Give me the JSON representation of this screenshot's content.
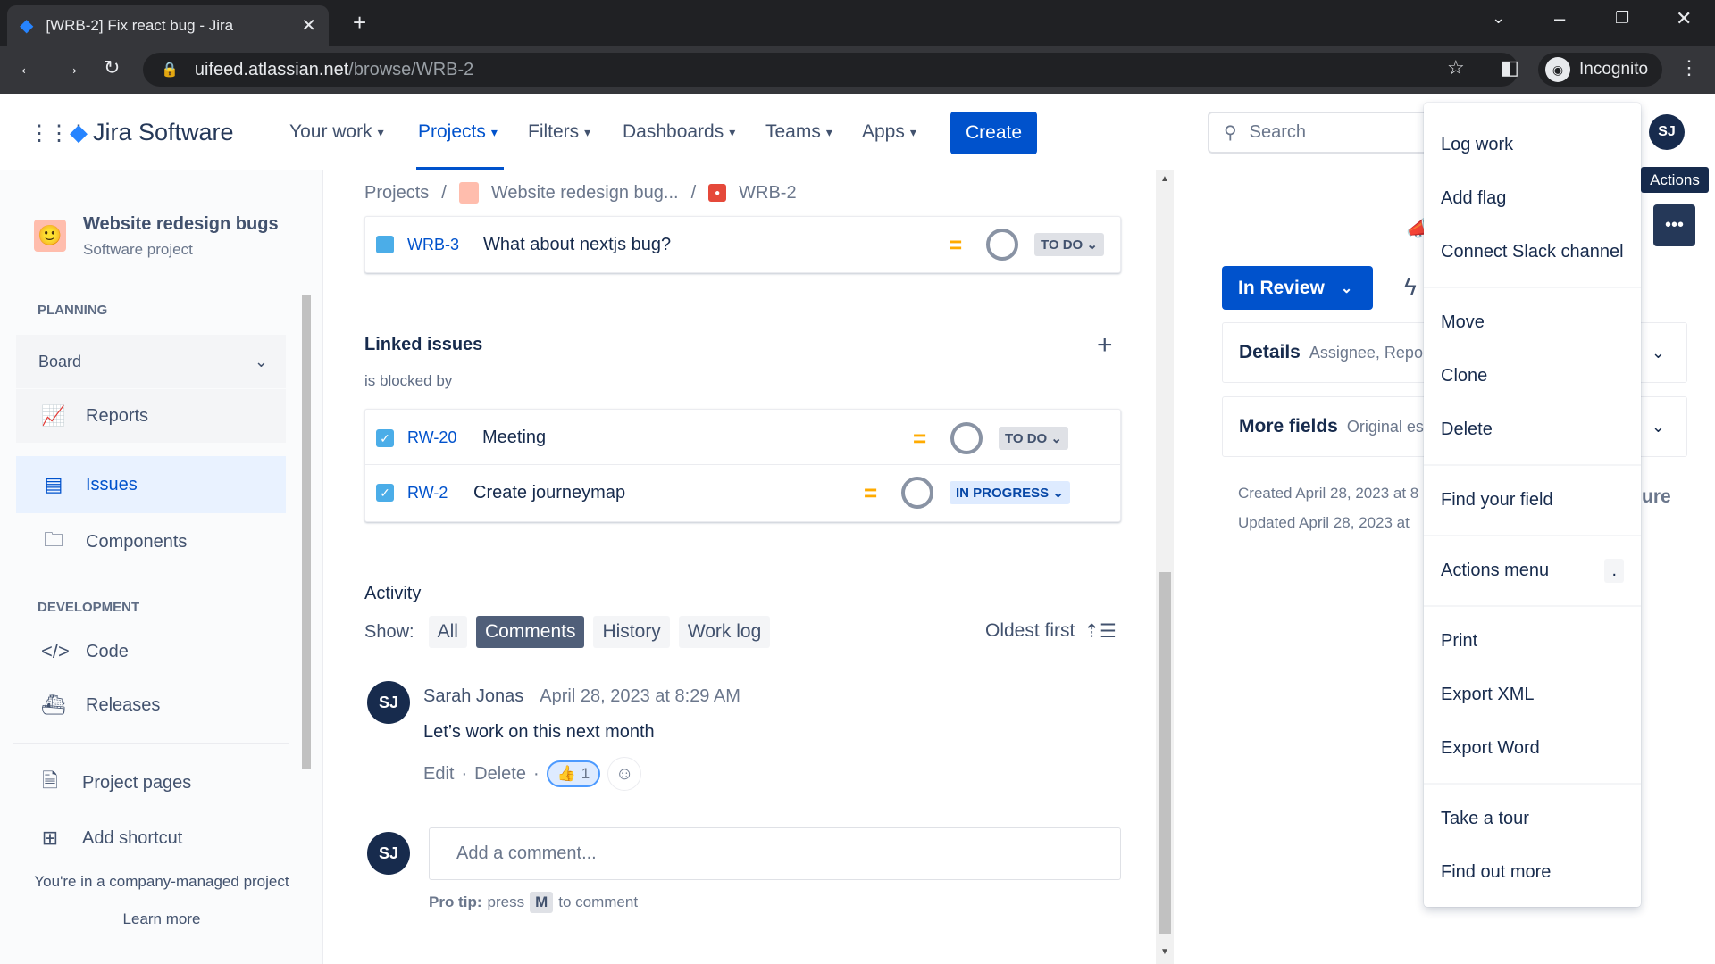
{
  "browser": {
    "tab_title": "[WRB-2] Fix react bug - Jira",
    "url_host": "uifeed.atlassian.net",
    "url_path": "/browse/WRB-2",
    "profile": "Incognito"
  },
  "header": {
    "product": "Jira Software",
    "nav": [
      "Your work",
      "Projects",
      "Filters",
      "Dashboards",
      "Teams",
      "Apps"
    ],
    "active_nav": "Projects",
    "create": "Create",
    "search_placeholder": "Search",
    "avatar": "SJ"
  },
  "sidebar": {
    "project_name": "Website redesign bugs",
    "project_type": "Software project",
    "planning_heading": "PLANNING",
    "board": "Board",
    "reports": "Reports",
    "issues": "Issues",
    "components": "Components",
    "development_heading": "DEVELOPMENT",
    "code": "Code",
    "releases": "Releases",
    "project_pages": "Project pages",
    "add_shortcut": "Add shortcut",
    "footer": "You're in a company-managed project",
    "learn_more": "Learn more"
  },
  "breadcrumb": [
    "Projects",
    "Website redesign bug...",
    "WRB-2"
  ],
  "child_issue": {
    "key": "WRB-3",
    "summary": "What about nextjs bug?",
    "status": "TO DO"
  },
  "linked": {
    "title": "Linked issues",
    "relation": "is blocked by",
    "issues": [
      {
        "key": "RW-20",
        "summary": "Meeting",
        "status": "TO DO"
      },
      {
        "key": "RW-2",
        "summary": "Create journeymap",
        "status": "IN PROGRESS"
      }
    ]
  },
  "activity": {
    "title": "Activity",
    "show_label": "Show:",
    "filters": [
      "All",
      "Comments",
      "History",
      "Work log"
    ],
    "selected_filter": "Comments",
    "sort": "Oldest first",
    "comment": {
      "avatar": "SJ",
      "author": "Sarah Jonas",
      "time": "April 28, 2023 at 8:29 AM",
      "body": "Let’s work on this next month",
      "edit": "Edit",
      "delete": "Delete",
      "reaction_count": "1"
    },
    "add_placeholder": "Add a comment...",
    "pro_tip_label": "Pro tip:",
    "pro_tip_pre": "press",
    "pro_tip_key": "M",
    "pro_tip_post": "to comment"
  },
  "right_panel": {
    "status": "In Review",
    "details": "Details",
    "details_hint": "Assignee, Reporte",
    "more_fields": "More fields",
    "more_fields_hint": "Original esti",
    "created": "Created April 28, 2023 at 8",
    "updated": "Updated April 28, 2023 at",
    "configure_fragment": "ure",
    "actions_tooltip": "Actions"
  },
  "actions_menu": {
    "items": [
      "Log work",
      "Add flag",
      "Connect Slack channel",
      "Move",
      "Clone",
      "Delete",
      "Find your field",
      "Actions menu",
      "Print",
      "Export XML",
      "Export Word",
      "Take a tour",
      "Find out more"
    ],
    "actions_menu_shortcut": "."
  },
  "colors": {
    "brand": "#0052cc",
    "priority_medium": "#ffab00",
    "avatar": "#172b4d"
  }
}
